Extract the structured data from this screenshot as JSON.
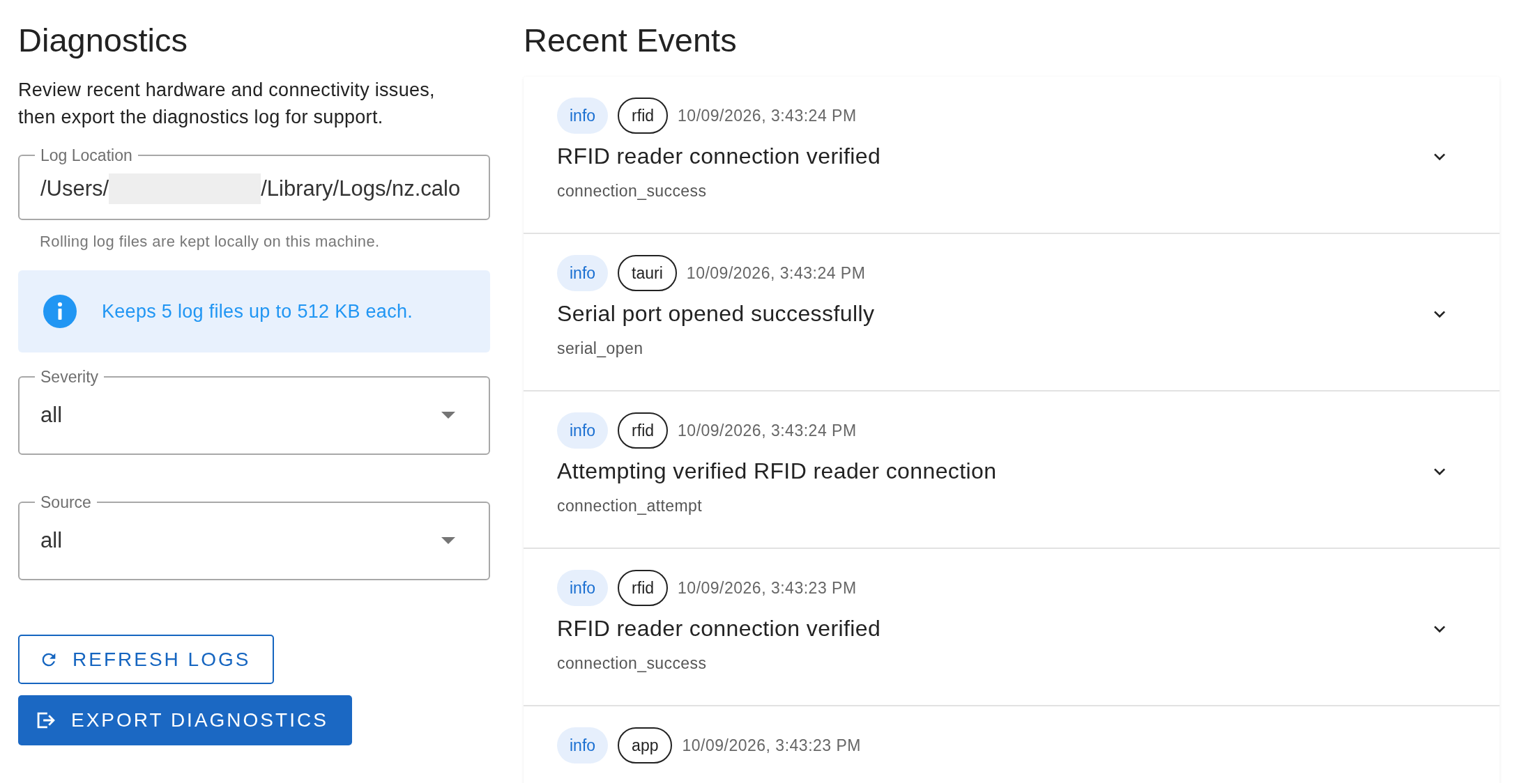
{
  "left": {
    "title": "Diagnostics",
    "description": "Review recent hardware and connectivity issues, then export the diagnostics log for support.",
    "log_location": {
      "label": "Log Location",
      "value_parts": [
        "/Users/",
        "/Library/Logs/nz.calo"
      ],
      "redacted": true,
      "helper": "Rolling log files are kept locally on this machine."
    },
    "alert": {
      "kind": "info",
      "text": "Keeps 5 log files up to 512 KB each."
    },
    "filters": [
      {
        "label": "Severity",
        "value": "all"
      },
      {
        "label": "Source",
        "value": "all"
      }
    ],
    "buttons": [
      {
        "kind": "refresh",
        "label": "REFRESH LOGS"
      },
      {
        "kind": "export",
        "label": "EXPORT DIAGNOSTICS"
      }
    ]
  },
  "right": {
    "title": "Recent Events",
    "events": [
      {
        "severity": "info",
        "source": "rfid",
        "time": "10/09/2026, 3:43:24 PM",
        "message": "RFID reader connection verified",
        "code": "connection_success",
        "expanded": false
      },
      {
        "severity": "info",
        "source": "tauri",
        "time": "10/09/2026, 3:43:24 PM",
        "message": "Serial port opened successfully",
        "code": "serial_open",
        "expanded": false
      },
      {
        "severity": "info",
        "source": "rfid",
        "time": "10/09/2026, 3:43:24 PM",
        "message": "Attempting verified RFID reader connection",
        "code": "connection_attempt",
        "expanded": false
      },
      {
        "severity": "info",
        "source": "rfid",
        "time": "10/09/2026, 3:43:23 PM",
        "message": "RFID reader connection verified",
        "code": "connection_success",
        "expanded": false
      },
      {
        "severity": "info",
        "source": "app",
        "time": "10/09/2026, 3:43:23 PM"
      }
    ]
  }
}
